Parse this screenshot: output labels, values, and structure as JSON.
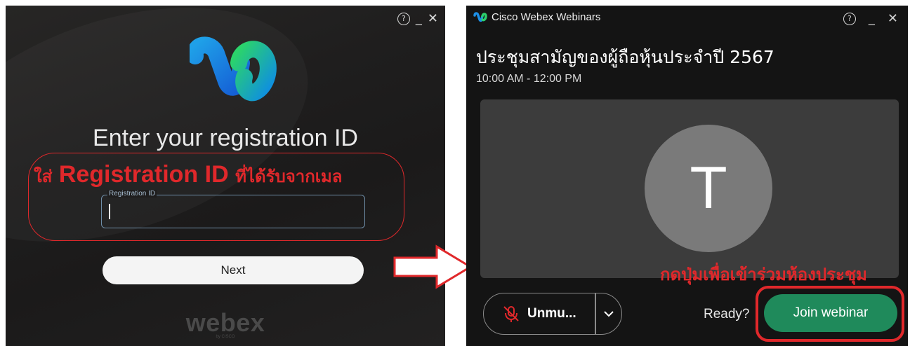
{
  "left_window": {
    "help_icon": "question-circle-icon",
    "minimize_glyph": "_",
    "close_glyph": "✕",
    "title": "Enter your registration ID",
    "annotation": {
      "prefix": "ใส่",
      "highlight": "Registration ID",
      "suffix": "ที่ได้รับจากเมล"
    },
    "field_label": "Registration ID",
    "field_value": "",
    "next_label": "Next",
    "brand": "webex",
    "brand_sub": "by CISCO"
  },
  "right_window": {
    "app_title": "Cisco Webex Webinars",
    "help_icon": "question-circle-icon",
    "minimize_glyph": "_",
    "close_glyph": "✕",
    "meeting_title": "ประชุมสามัญของผู้ถือหุ้นประจำปี 2567",
    "time": "10:00 AM - 12:00 PM",
    "avatar_initial": "T",
    "annotation": "กดปุ่มเพื่อเข้าร่วมห้องประชุม",
    "unmute_label": "Unmu...",
    "ready_label": "Ready?",
    "join_label": "Join webinar"
  },
  "colors": {
    "annotation_red": "#e0282b",
    "join_green": "#1f8a5b"
  }
}
